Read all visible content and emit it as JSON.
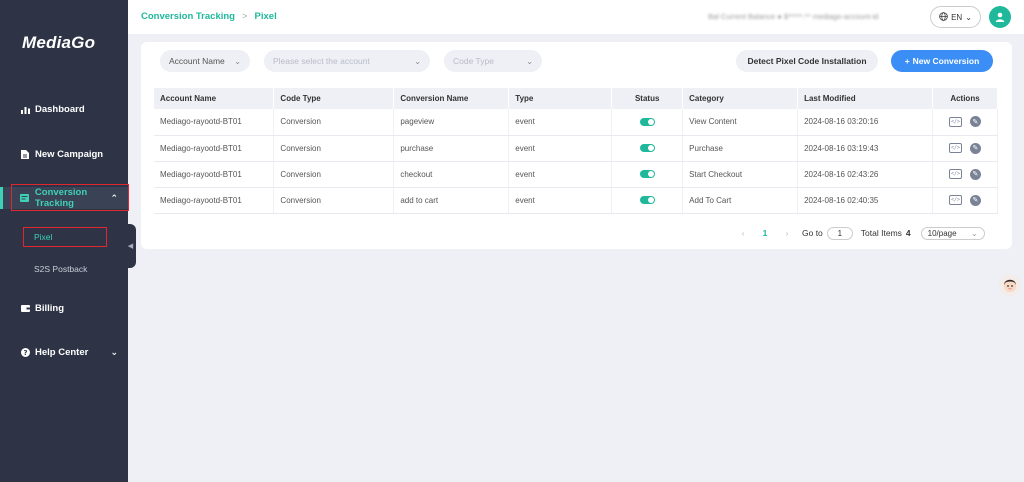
{
  "sidebar": {
    "logo": "MediaGo",
    "items": [
      {
        "label": "Dashboard",
        "icon": "chart-icon"
      },
      {
        "label": "New Campaign",
        "icon": "document-icon"
      },
      {
        "label": "Conversion Tracking",
        "icon": "tracking-icon",
        "active": true
      },
      {
        "label": "Billing",
        "icon": "wallet-icon"
      },
      {
        "label": "Help Center",
        "icon": "help-icon"
      }
    ],
    "sub_items": [
      {
        "label": "Pixel",
        "active": true
      },
      {
        "label": "S2S Postback"
      }
    ],
    "active_color": "#3ed1b5"
  },
  "header": {
    "breadcrumb": [
      "Conversion Tracking",
      "Pixel"
    ],
    "balance_text": "Bal Current Balance ● $*****.** mediago-account-id",
    "language": "EN"
  },
  "filters": {
    "account_name_label": "Account Name",
    "account_placeholder": "Please select the account",
    "code_type_placeholder": "Code Type"
  },
  "buttons": {
    "detect": "Detect Pixel Code Installation",
    "new_conversion": "New Conversion"
  },
  "table": {
    "columns": [
      "Account Name",
      "Code Type",
      "Conversion Name",
      "Type",
      "Status",
      "Category",
      "Last Modified",
      "Actions"
    ],
    "rows": [
      {
        "account": "Mediago-rayootd-BT01",
        "code_type": "Conversion",
        "name": "pageview",
        "type": "event",
        "status": "on",
        "category": "View Content",
        "modified": "2024-08-16 03:20:16"
      },
      {
        "account": "Mediago-rayootd-BT01",
        "code_type": "Conversion",
        "name": "purchase",
        "type": "event",
        "status": "on",
        "category": "Purchase",
        "modified": "2024-08-16 03:19:43"
      },
      {
        "account": "Mediago-rayootd-BT01",
        "code_type": "Conversion",
        "name": "checkout",
        "type": "event",
        "status": "on",
        "category": "Start Checkout",
        "modified": "2024-08-16 02:43:26"
      },
      {
        "account": "Mediago-rayootd-BT01",
        "code_type": "Conversion",
        "name": "add to cart",
        "type": "event",
        "status": "on",
        "category": "Add To Cart",
        "modified": "2024-08-16 02:40:35"
      }
    ]
  },
  "pagination": {
    "current_page": "1",
    "goto_label": "Go to",
    "goto_value": "1",
    "total_label": "Total Items",
    "total_value": "4",
    "page_size": "10/page"
  },
  "colors": {
    "accent_green": "#1fb89b",
    "primary_blue": "#3a8ef6",
    "sidebar_bg": "#2e3446",
    "highlight_red": "#e0262f"
  }
}
